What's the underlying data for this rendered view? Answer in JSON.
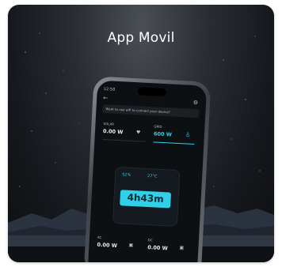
{
  "card": {
    "title": "App Movil"
  },
  "phone": {
    "status_time": "12:58",
    "prompt": "Want to use wifi to connect your device?",
    "solar_label": "SOLAR",
    "solar_value": "0.00 W",
    "grid_label": "GRID",
    "grid_value": "600 W",
    "battery_percent": "52%",
    "battery_temp": "27°C",
    "remaining_time": "4h43m",
    "ac_label": "AC",
    "ac_value": "0.00 W",
    "dc_label": "DC",
    "dc_value": "0.00 W"
  },
  "colors": {
    "accent": "#2fd0e8",
    "background": "#15181c",
    "title_text": "#ffffff"
  }
}
